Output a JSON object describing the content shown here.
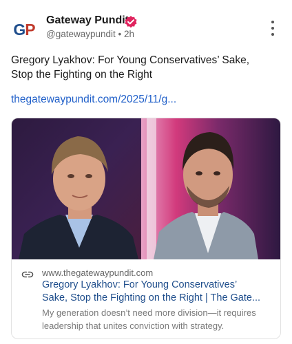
{
  "author": {
    "avatar_text_g": "G",
    "avatar_text_p": "P",
    "name": "Gateway Pundit",
    "handle": "@gatewaypundit",
    "separator": "•",
    "time": "2h",
    "verified_color": "#e0245e"
  },
  "post": {
    "text_line1": "Gregory Lyakhov: For Young Conservatives’ Sake,",
    "text_line2": "Stop the Fighting on the Right",
    "link": "thegatewaypundit.com/2025/11/g..."
  },
  "card": {
    "domain": "www.thegatewaypundit.com",
    "title_line1": "Gregory Lyakhov: For Young Conservatives’",
    "title_line2": "Sake, Stop the Fighting on the Right | The Gate...",
    "desc_line1": "My generation doesn’t need more division—it requires",
    "desc_line2": "leadership that unites conviction with strategy."
  },
  "icons": {
    "verified": "verified-badge-icon",
    "more": "more-vertical-icon",
    "link": "link-icon"
  },
  "colors": {
    "link_blue": "#1f5fc9",
    "brand_blue": "#1f4e8c",
    "brand_red": "#c0392b"
  }
}
